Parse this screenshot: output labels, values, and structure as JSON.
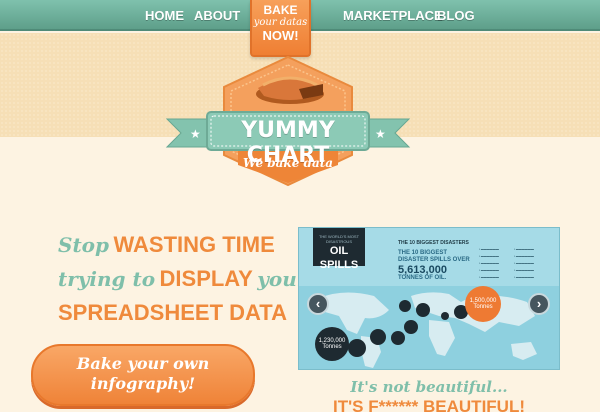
{
  "nav": {
    "items": [
      {
        "label": "HOME"
      },
      {
        "label": "ABOUT"
      },
      {
        "label": "MARKETPLACE"
      },
      {
        "label": "BLOG"
      }
    ],
    "cta": {
      "line1": "BAKE",
      "line2": "your datas",
      "line3": "NOW!"
    }
  },
  "logo": {
    "title": "YUMMY CHART",
    "tagline": "We bake data",
    "icon": "pie-icon"
  },
  "headline": {
    "l1_script": "Stop",
    "l1_bold": "WASTING TIME",
    "l2_script_a": "trying to",
    "l2_bold": "DISPLAY",
    "l2_script_b": "your",
    "l3_bold": "SPREADSHEET DATA"
  },
  "bake_button": {
    "line1": "Bake your own",
    "line2": "infography!"
  },
  "preview": {
    "badge_small": "THE WORLD'S MOST DISASTROUS",
    "badge_big": "OIL SPILLS",
    "heading": "THE 10 BIGGEST DISASTERS",
    "sub1": "THE 10 BIGGEST",
    "sub2": "DISASTER SPILLS OVER",
    "total": "5,613,000",
    "unit": "TONNES OF OIL.",
    "bubbles": [
      {
        "value": "1,500,000",
        "unit": "Tonnes"
      },
      {
        "value": "1,230,000",
        "unit": "Tonnes"
      }
    ],
    "prev_icon": "chevron-left-icon",
    "next_icon": "chevron-right-icon"
  },
  "tagline": {
    "line1": "It's not beautiful...",
    "line2": "IT'S F****** BEAUTIFUL!"
  },
  "colors": {
    "nav": "#6aa995",
    "accent_orange": "#ef8a3c",
    "accent_teal": "#7fbfaa",
    "background": "#fdf3e2",
    "header_band": "#f6dfb6"
  }
}
